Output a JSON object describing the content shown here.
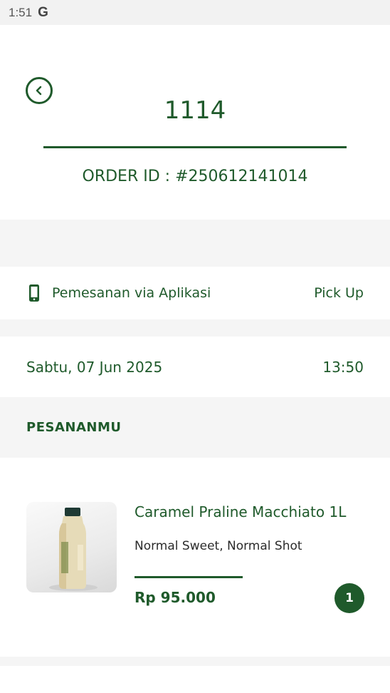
{
  "status_bar": {
    "time": "1:51",
    "google_glyph": "G"
  },
  "header": {
    "queue_number": "1114",
    "order_id": "ORDER ID : #250612141014"
  },
  "order_method": {
    "label": "Pemesanan via Aplikasi",
    "type": "Pick Up",
    "icon": "phone-icon"
  },
  "order_datetime": {
    "date": "Sabtu, 07 Jun 2025",
    "time": "13:50"
  },
  "section": {
    "title": "PESANANMU"
  },
  "items": [
    {
      "name": "Caramel Praline Macchiato 1L",
      "options": "Normal Sweet, Normal Shot",
      "price": "Rp 95.000",
      "quantity": "1"
    }
  ],
  "colors": {
    "primary": "#1f5a2b",
    "background_gray": "#f5f5f5"
  }
}
